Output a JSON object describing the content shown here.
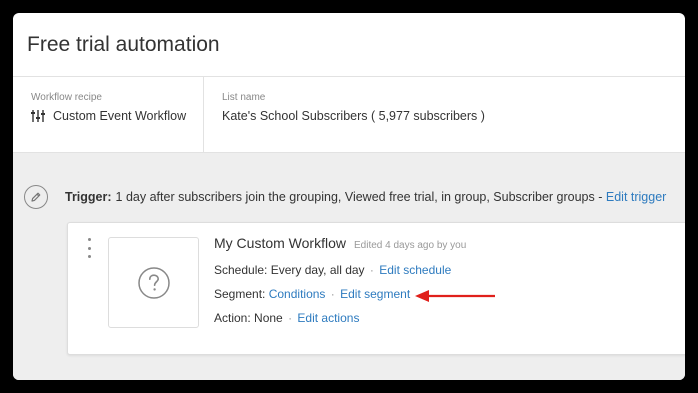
{
  "page": {
    "title": "Free trial automation"
  },
  "meta": {
    "recipe_label": "Workflow recipe",
    "recipe_value": "Custom Event Workflow",
    "recipe_icon": "sliders-icon",
    "list_label": "List name",
    "list_value": "Kate's School Subscribers ( 5,977 subscribers )"
  },
  "trigger": {
    "icon": "pencil-icon",
    "label": "Trigger:",
    "text": "1 day after subscribers join the grouping, Viewed free trial, in group, Subscriber groups -",
    "edit_link": "Edit trigger"
  },
  "step": {
    "title": "My Custom Workflow",
    "edited": "Edited 4 days ago by you",
    "thumbnail_icon": "question-circle-icon",
    "schedule_label": "Schedule:",
    "schedule_value": "Every day, all day",
    "schedule_edit": "Edit schedule",
    "segment_label": "Segment:",
    "segment_value": "Conditions",
    "segment_edit": "Edit segment",
    "action_label": "Action:",
    "action_value": "None",
    "action_edit": "Edit actions",
    "separator": "·"
  },
  "colors": {
    "link": "#2e7bbf",
    "canvas": "#eeeeee",
    "annotation_arrow": "#e0201b"
  }
}
